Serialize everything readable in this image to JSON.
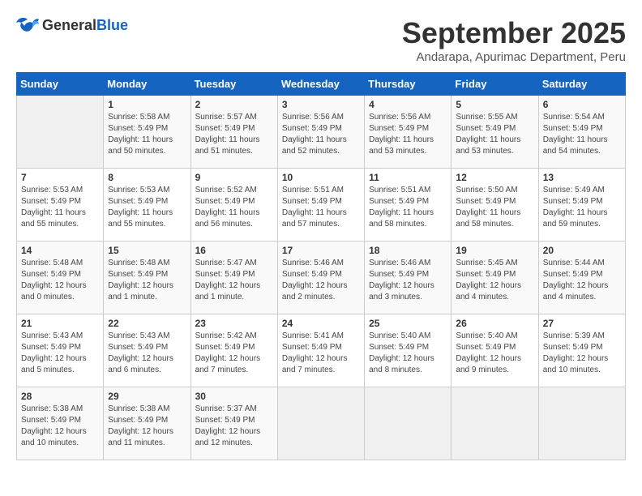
{
  "header": {
    "logo_general": "General",
    "logo_blue": "Blue",
    "month_title": "September 2025",
    "subtitle": "Andarapa, Apurimac Department, Peru"
  },
  "days_of_week": [
    "Sunday",
    "Monday",
    "Tuesday",
    "Wednesday",
    "Thursday",
    "Friday",
    "Saturday"
  ],
  "weeks": [
    [
      {
        "day": "",
        "content": ""
      },
      {
        "day": "1",
        "content": "Sunrise: 5:58 AM\nSunset: 5:49 PM\nDaylight: 11 hours\nand 50 minutes."
      },
      {
        "day": "2",
        "content": "Sunrise: 5:57 AM\nSunset: 5:49 PM\nDaylight: 11 hours\nand 51 minutes."
      },
      {
        "day": "3",
        "content": "Sunrise: 5:56 AM\nSunset: 5:49 PM\nDaylight: 11 hours\nand 52 minutes."
      },
      {
        "day": "4",
        "content": "Sunrise: 5:56 AM\nSunset: 5:49 PM\nDaylight: 11 hours\nand 53 minutes."
      },
      {
        "day": "5",
        "content": "Sunrise: 5:55 AM\nSunset: 5:49 PM\nDaylight: 11 hours\nand 53 minutes."
      },
      {
        "day": "6",
        "content": "Sunrise: 5:54 AM\nSunset: 5:49 PM\nDaylight: 11 hours\nand 54 minutes."
      }
    ],
    [
      {
        "day": "7",
        "content": "Sunrise: 5:53 AM\nSunset: 5:49 PM\nDaylight: 11 hours\nand 55 minutes."
      },
      {
        "day": "8",
        "content": "Sunrise: 5:53 AM\nSunset: 5:49 PM\nDaylight: 11 hours\nand 55 minutes."
      },
      {
        "day": "9",
        "content": "Sunrise: 5:52 AM\nSunset: 5:49 PM\nDaylight: 11 hours\nand 56 minutes."
      },
      {
        "day": "10",
        "content": "Sunrise: 5:51 AM\nSunset: 5:49 PM\nDaylight: 11 hours\nand 57 minutes."
      },
      {
        "day": "11",
        "content": "Sunrise: 5:51 AM\nSunset: 5:49 PM\nDaylight: 11 hours\nand 58 minutes."
      },
      {
        "day": "12",
        "content": "Sunrise: 5:50 AM\nSunset: 5:49 PM\nDaylight: 11 hours\nand 58 minutes."
      },
      {
        "day": "13",
        "content": "Sunrise: 5:49 AM\nSunset: 5:49 PM\nDaylight: 11 hours\nand 59 minutes."
      }
    ],
    [
      {
        "day": "14",
        "content": "Sunrise: 5:48 AM\nSunset: 5:49 PM\nDaylight: 12 hours\nand 0 minutes."
      },
      {
        "day": "15",
        "content": "Sunrise: 5:48 AM\nSunset: 5:49 PM\nDaylight: 12 hours\nand 1 minute."
      },
      {
        "day": "16",
        "content": "Sunrise: 5:47 AM\nSunset: 5:49 PM\nDaylight: 12 hours\nand 1 minute."
      },
      {
        "day": "17",
        "content": "Sunrise: 5:46 AM\nSunset: 5:49 PM\nDaylight: 12 hours\nand 2 minutes."
      },
      {
        "day": "18",
        "content": "Sunrise: 5:46 AM\nSunset: 5:49 PM\nDaylight: 12 hours\nand 3 minutes."
      },
      {
        "day": "19",
        "content": "Sunrise: 5:45 AM\nSunset: 5:49 PM\nDaylight: 12 hours\nand 4 minutes."
      },
      {
        "day": "20",
        "content": "Sunrise: 5:44 AM\nSunset: 5:49 PM\nDaylight: 12 hours\nand 4 minutes."
      }
    ],
    [
      {
        "day": "21",
        "content": "Sunrise: 5:43 AM\nSunset: 5:49 PM\nDaylight: 12 hours\nand 5 minutes."
      },
      {
        "day": "22",
        "content": "Sunrise: 5:43 AM\nSunset: 5:49 PM\nDaylight: 12 hours\nand 6 minutes."
      },
      {
        "day": "23",
        "content": "Sunrise: 5:42 AM\nSunset: 5:49 PM\nDaylight: 12 hours\nand 7 minutes."
      },
      {
        "day": "24",
        "content": "Sunrise: 5:41 AM\nSunset: 5:49 PM\nDaylight: 12 hours\nand 7 minutes."
      },
      {
        "day": "25",
        "content": "Sunrise: 5:40 AM\nSunset: 5:49 PM\nDaylight: 12 hours\nand 8 minutes."
      },
      {
        "day": "26",
        "content": "Sunrise: 5:40 AM\nSunset: 5:49 PM\nDaylight: 12 hours\nand 9 minutes."
      },
      {
        "day": "27",
        "content": "Sunrise: 5:39 AM\nSunset: 5:49 PM\nDaylight: 12 hours\nand 10 minutes."
      }
    ],
    [
      {
        "day": "28",
        "content": "Sunrise: 5:38 AM\nSunset: 5:49 PM\nDaylight: 12 hours\nand 10 minutes."
      },
      {
        "day": "29",
        "content": "Sunrise: 5:38 AM\nSunset: 5:49 PM\nDaylight: 12 hours\nand 11 minutes."
      },
      {
        "day": "30",
        "content": "Sunrise: 5:37 AM\nSunset: 5:49 PM\nDaylight: 12 hours\nand 12 minutes."
      },
      {
        "day": "",
        "content": ""
      },
      {
        "day": "",
        "content": ""
      },
      {
        "day": "",
        "content": ""
      },
      {
        "day": "",
        "content": ""
      }
    ]
  ]
}
